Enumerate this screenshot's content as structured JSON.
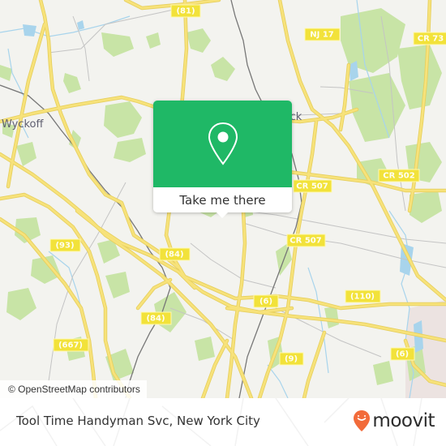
{
  "map": {
    "colors": {
      "land": "#f3f3ef",
      "park": "#c8e4a6",
      "water": "#a8d4ec",
      "road_major": "#f7e27a",
      "road_casing": "#e6cf5e",
      "road_minor": "#c4c4c4",
      "rail": "#777777",
      "urban": "#ece3e1"
    },
    "place_labels": [
      {
        "id": "wyckoff",
        "text": "Wyckoff"
      },
      {
        "id": "ridgewick",
        "text": "ick"
      }
    ],
    "route_shields": [
      {
        "id": "r81",
        "text": "(81)"
      },
      {
        "id": "nj17",
        "text": "NJ 17"
      },
      {
        "id": "cr73",
        "text": "CR 73"
      },
      {
        "id": "cr502",
        "text": "CR 502"
      },
      {
        "id": "cr507a",
        "text": "CR 507"
      },
      {
        "id": "cr507b",
        "text": "CR 507"
      },
      {
        "id": "r93",
        "text": "(93)"
      },
      {
        "id": "r84a",
        "text": "(84)"
      },
      {
        "id": "r84b",
        "text": "(84)"
      },
      {
        "id": "r667",
        "text": "(667)"
      },
      {
        "id": "r6a",
        "text": "(6)"
      },
      {
        "id": "r110",
        "text": "(110)"
      },
      {
        "id": "r9",
        "text": "(9)"
      },
      {
        "id": "r6b",
        "text": "(6)"
      }
    ]
  },
  "popup": {
    "icon": "map-pin-icon",
    "button_label": "Take me there",
    "accent_color": "#1fb866"
  },
  "attribution": {
    "text": "© OpenStreetMap contributors"
  },
  "footer": {
    "title": "Tool Time Handyman Svc, New York City",
    "logo": {
      "icon": "moovit-pin-icon",
      "wordmark": "moovit",
      "brand_color": "#f26b3a"
    }
  }
}
